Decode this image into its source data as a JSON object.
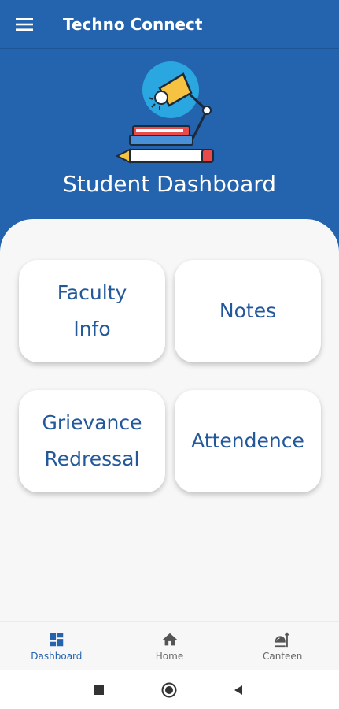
{
  "app": {
    "title": "Techno Connect"
  },
  "hero": {
    "title": "Student Dashboard"
  },
  "cards": [
    {
      "line1": "Faculty",
      "line2": "Info"
    },
    {
      "line1": "Notes",
      "line2": ""
    },
    {
      "line1": "Grievance",
      "line2": "Redressal"
    },
    {
      "line1": "Attendence",
      "line2": ""
    }
  ],
  "bottom_nav": [
    {
      "label": "Dashboard",
      "icon": "dashboard-icon",
      "active": true
    },
    {
      "label": "Home",
      "icon": "home-icon",
      "active": false
    },
    {
      "label": "Canteen",
      "icon": "canteen-icon",
      "active": false
    }
  ],
  "colors": {
    "primary": "#2463ad",
    "card_text": "#23599b",
    "background": "#f7f7f7"
  }
}
